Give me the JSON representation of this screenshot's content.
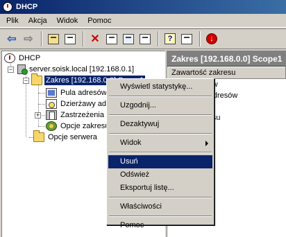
{
  "window": {
    "title": "DHCP"
  },
  "menubar": {
    "items": [
      "Plik",
      "Akcja",
      "Widok",
      "Pomoc"
    ]
  },
  "toolbar": {
    "buttons": [
      "back-icon",
      "forward-icon",
      "up-folder-icon",
      "show-hide-tree-icon",
      "delete-icon",
      "properties-icon",
      "refresh-icon",
      "export-list-icon",
      "help-icon",
      "action-pane-icon",
      "stop-icon"
    ]
  },
  "tree": {
    "root": "DHCP",
    "server": "server.soisk.local [192.168.0.1]",
    "scope": "Zakres [192.168.0.0] Scope1",
    "scope_children": [
      "Pula adresów",
      "Dzierżawy adresów",
      "Zastrzeżenia",
      "Opcje zakresu"
    ],
    "server_options": "Opcje serwera"
  },
  "right_pane": {
    "title": "Zakres [192.168.0.0] Scope1",
    "column_header": "Zawartość zakresu",
    "rows": [
      "Pula adresów",
      "Dzierżawy adresów",
      "Zastrzeżenia",
      "Opcje zakresu"
    ]
  },
  "context_menu": {
    "items": [
      {
        "label": "Wyświetl statystykę...",
        "type": "item"
      },
      {
        "type": "separator"
      },
      {
        "label": "Uzgodnij...",
        "type": "item"
      },
      {
        "type": "separator"
      },
      {
        "label": "Dezaktywuj",
        "type": "item"
      },
      {
        "type": "separator"
      },
      {
        "label": "Widok",
        "type": "submenu"
      },
      {
        "type": "separator"
      },
      {
        "label": "Usuń",
        "type": "item",
        "highlighted": true
      },
      {
        "label": "Odśwież",
        "type": "item"
      },
      {
        "label": "Eksportuj listę...",
        "type": "item"
      },
      {
        "type": "separator"
      },
      {
        "label": "Właściwości",
        "type": "item"
      },
      {
        "type": "separator"
      },
      {
        "label": "Pomoc",
        "type": "item"
      }
    ]
  },
  "colors": {
    "title_bar": "#0a246a",
    "selection": "#0a246a",
    "pane_header": "#808080",
    "window_bg": "#d4d0c8"
  }
}
